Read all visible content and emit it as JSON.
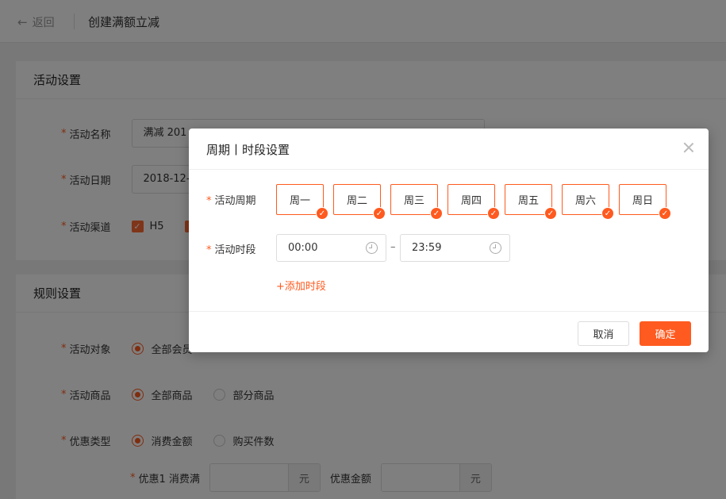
{
  "header": {
    "back_label": "返回",
    "title": "创建满额立减"
  },
  "activity_settings": {
    "title": "活动设置",
    "name": {
      "label": "活动名称",
      "value": "满减  201"
    },
    "date": {
      "label": "活动日期",
      "value": "2018-12-"
    },
    "channel": {
      "label": "活动渠道",
      "options": [
        "H5"
      ]
    }
  },
  "rule_settings": {
    "title": "规则设置",
    "target": {
      "label": "活动对象",
      "options": [
        "全部会员"
      ]
    },
    "goods": {
      "label": "活动商品",
      "options": [
        "全部商品",
        "部分商品"
      ]
    },
    "discount_type": {
      "label": "优惠类型",
      "options": [
        "消费金额",
        "购买件数"
      ]
    },
    "tier1": {
      "label": "优惠1 消费满",
      "unit": "元",
      "amount_label": "优惠金额",
      "amount_unit": "元"
    }
  },
  "modal": {
    "title": "周期丨时段设置",
    "cycle_label": "活动周期",
    "days": [
      "周一",
      "周二",
      "周三",
      "周四",
      "周五",
      "周六",
      "周日"
    ],
    "period_label": "活动时段",
    "start_time": "00:00",
    "separator": "–",
    "end_time": "23:59",
    "add_period": "+添加时段",
    "cancel": "取消",
    "confirm": "确定"
  },
  "colors": {
    "accent": "#ff5a1f",
    "mask": "rgba(0,0,0,0.5)"
  }
}
